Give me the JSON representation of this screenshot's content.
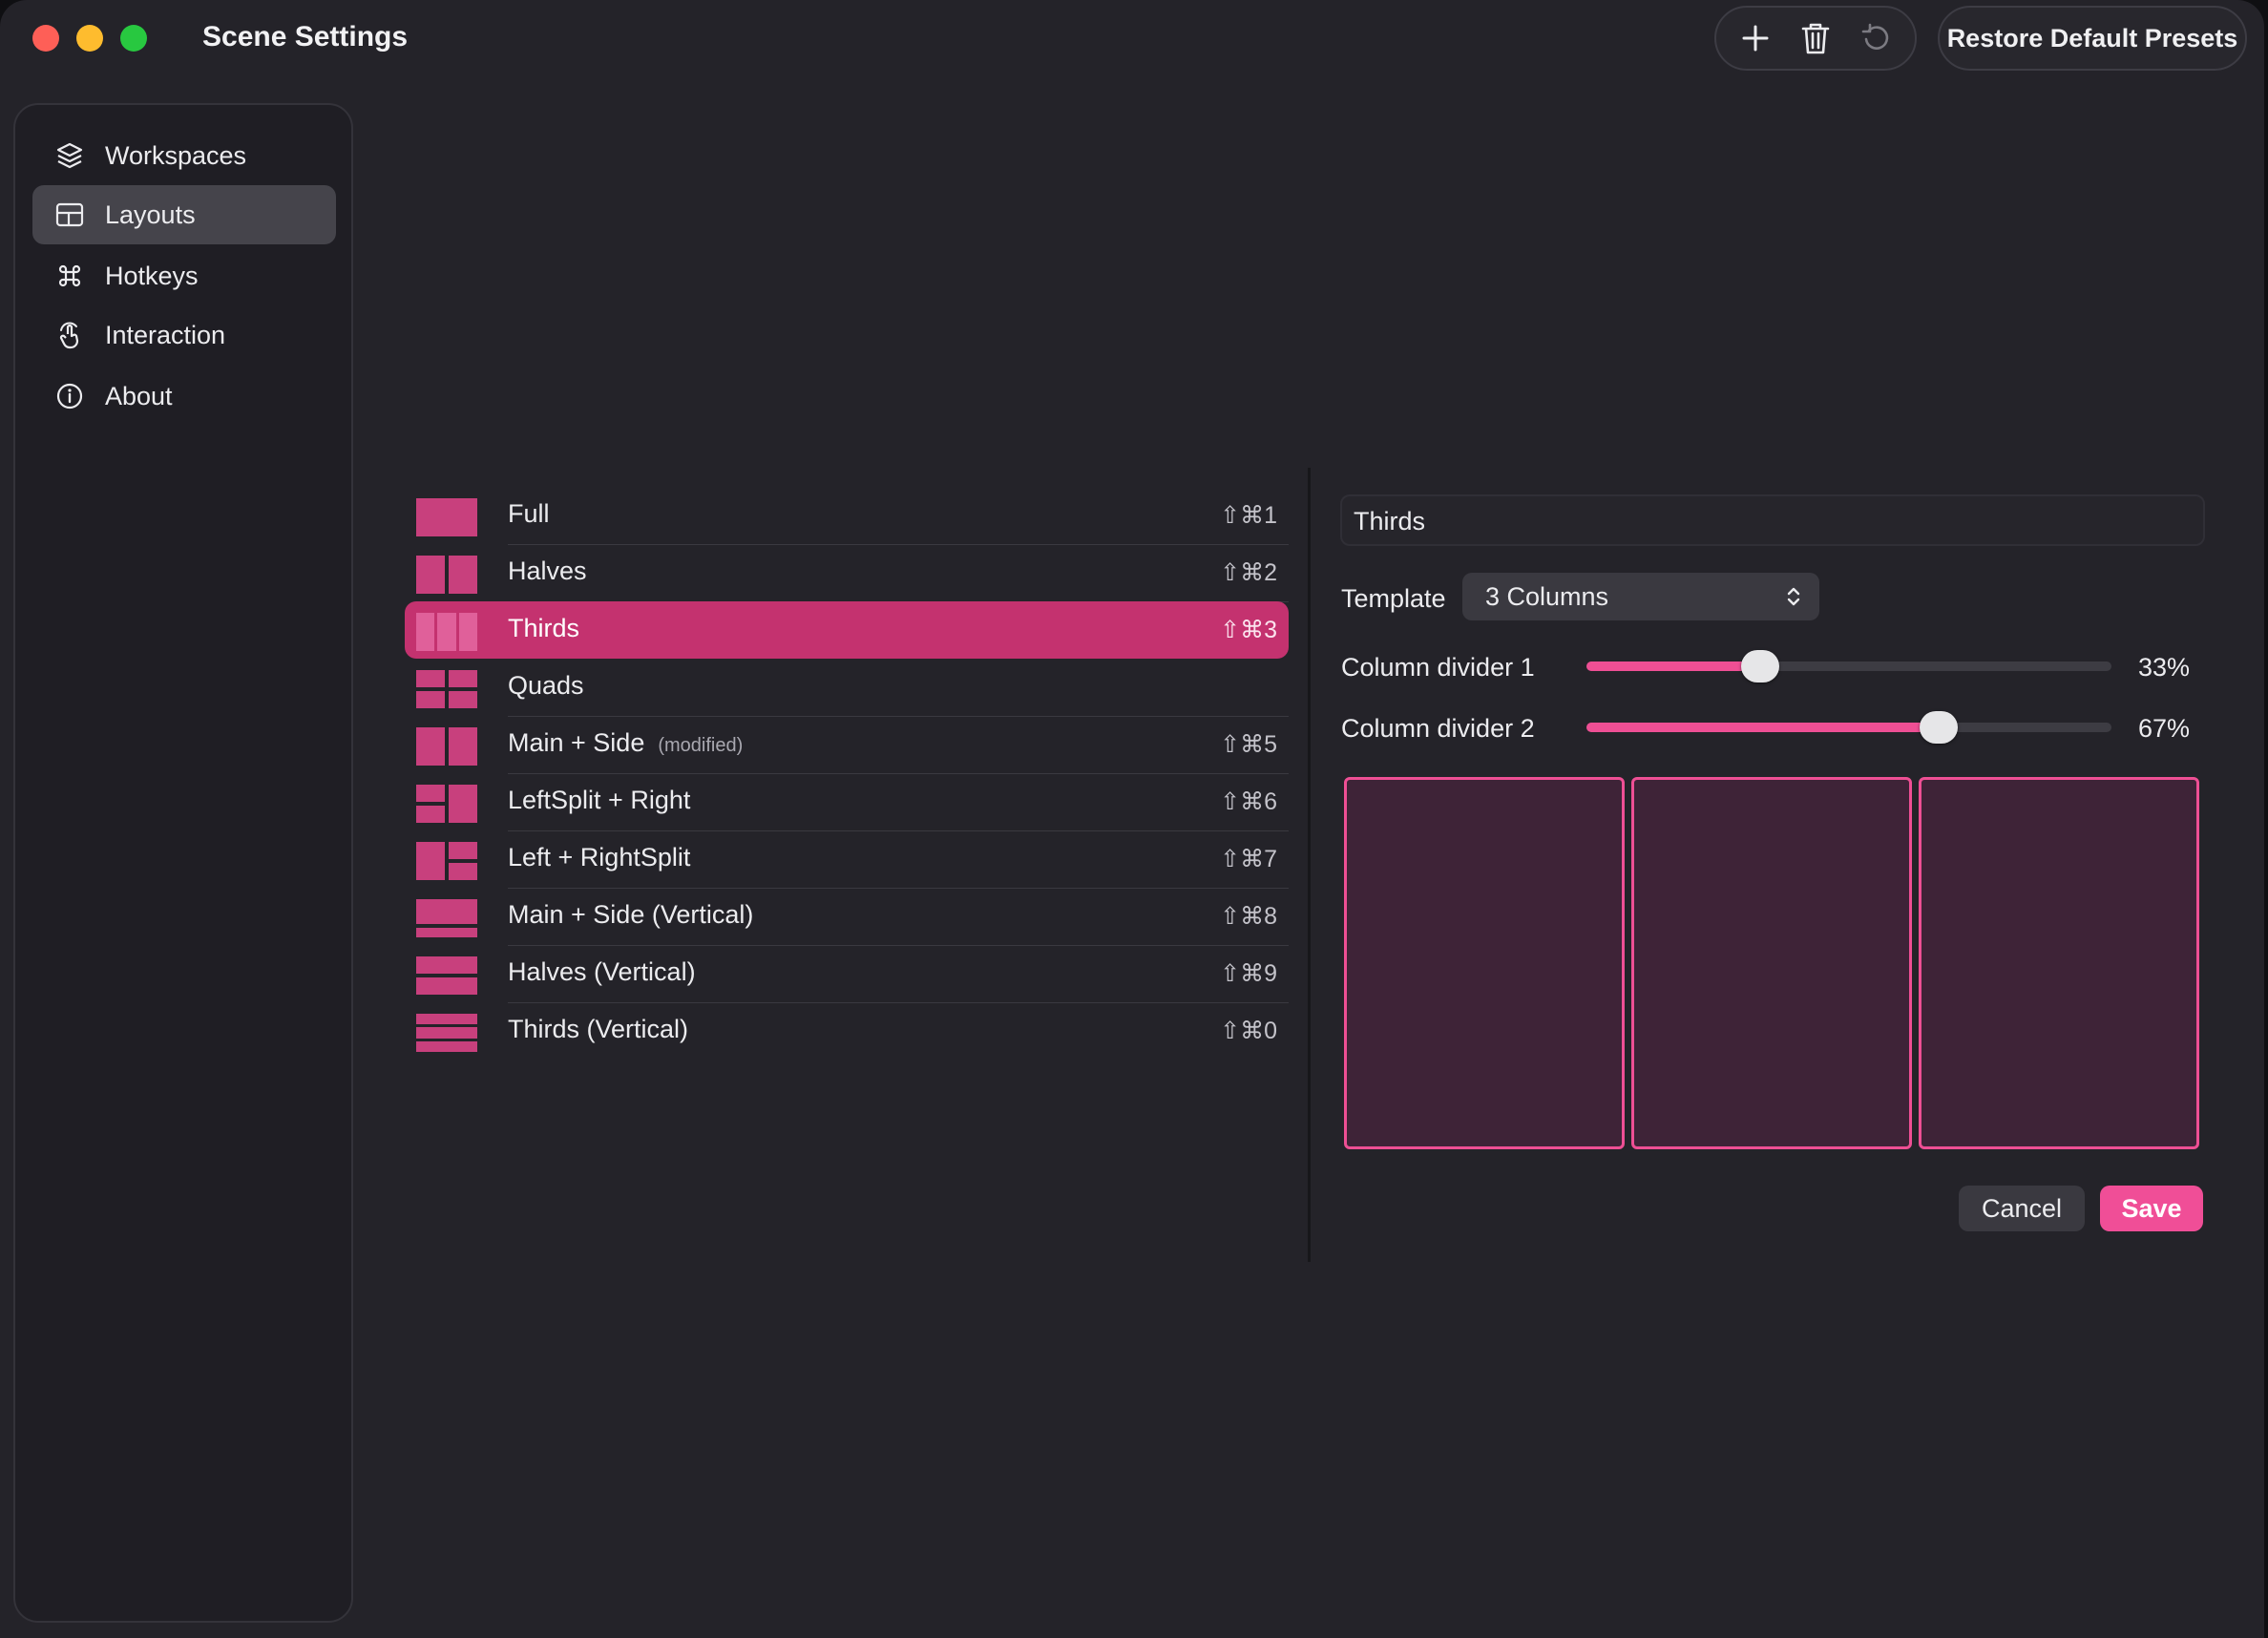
{
  "window": {
    "title": "Scene Settings"
  },
  "toolbar": {
    "add_icon": "plus-icon",
    "delete_icon": "trash-icon",
    "revert_icon": "undo-icon",
    "restore_label": "Restore Default Presets"
  },
  "sidebar": {
    "items": [
      {
        "label": "Workspaces",
        "icon": "stack-icon",
        "active": false
      },
      {
        "label": "Layouts",
        "icon": "grid-icon",
        "active": true
      },
      {
        "label": "Hotkeys",
        "icon": "command-icon",
        "active": false
      },
      {
        "label": "Interaction",
        "icon": "hand-pointer-icon",
        "active": false
      },
      {
        "label": "About",
        "icon": "info-icon",
        "active": false
      }
    ]
  },
  "layouts": [
    {
      "name": "Full",
      "badge": "",
      "shortcut": "⇧⌘1",
      "thumb": "full"
    },
    {
      "name": "Halves",
      "badge": "",
      "shortcut": "⇧⌘2",
      "thumb": "halves"
    },
    {
      "name": "Thirds",
      "badge": "",
      "shortcut": "⇧⌘3",
      "thumb": "thirds",
      "selected": true
    },
    {
      "name": "Quads",
      "badge": "",
      "shortcut": "",
      "thumb": "quads"
    },
    {
      "name": "Main + Side",
      "badge": "(modified)",
      "shortcut": "⇧⌘5",
      "thumb": "main-side"
    },
    {
      "name": "LeftSplit + Right",
      "badge": "",
      "shortcut": "⇧⌘6",
      "thumb": "leftsplit-right"
    },
    {
      "name": "Left + RightSplit",
      "badge": "",
      "shortcut": "⇧⌘7",
      "thumb": "left-rightsplit"
    },
    {
      "name": "Main + Side (Vertical)",
      "badge": "",
      "shortcut": "⇧⌘8",
      "thumb": "main-side-v"
    },
    {
      "name": "Halves (Vertical)",
      "badge": "",
      "shortcut": "⇧⌘9",
      "thumb": "halves-v"
    },
    {
      "name": "Thirds (Vertical)",
      "badge": "",
      "shortcut": "⇧⌘0",
      "thumb": "thirds-v"
    }
  ],
  "editor": {
    "name_value": "Thirds",
    "template_label": "Template",
    "template_value": "3 Columns",
    "divider1_label": "Column divider 1",
    "divider1_value": 0.33,
    "divider1_text": "33%",
    "divider2_label": "Column divider 2",
    "divider2_value": 0.67,
    "divider2_text": "67%",
    "cancel_label": "Cancel",
    "save_label": "Save"
  },
  "colors": {
    "accent": "#f04e97",
    "selected_row": "#c4326f",
    "thumb": "#c8407d",
    "preview_fill": "#3e2337"
  }
}
